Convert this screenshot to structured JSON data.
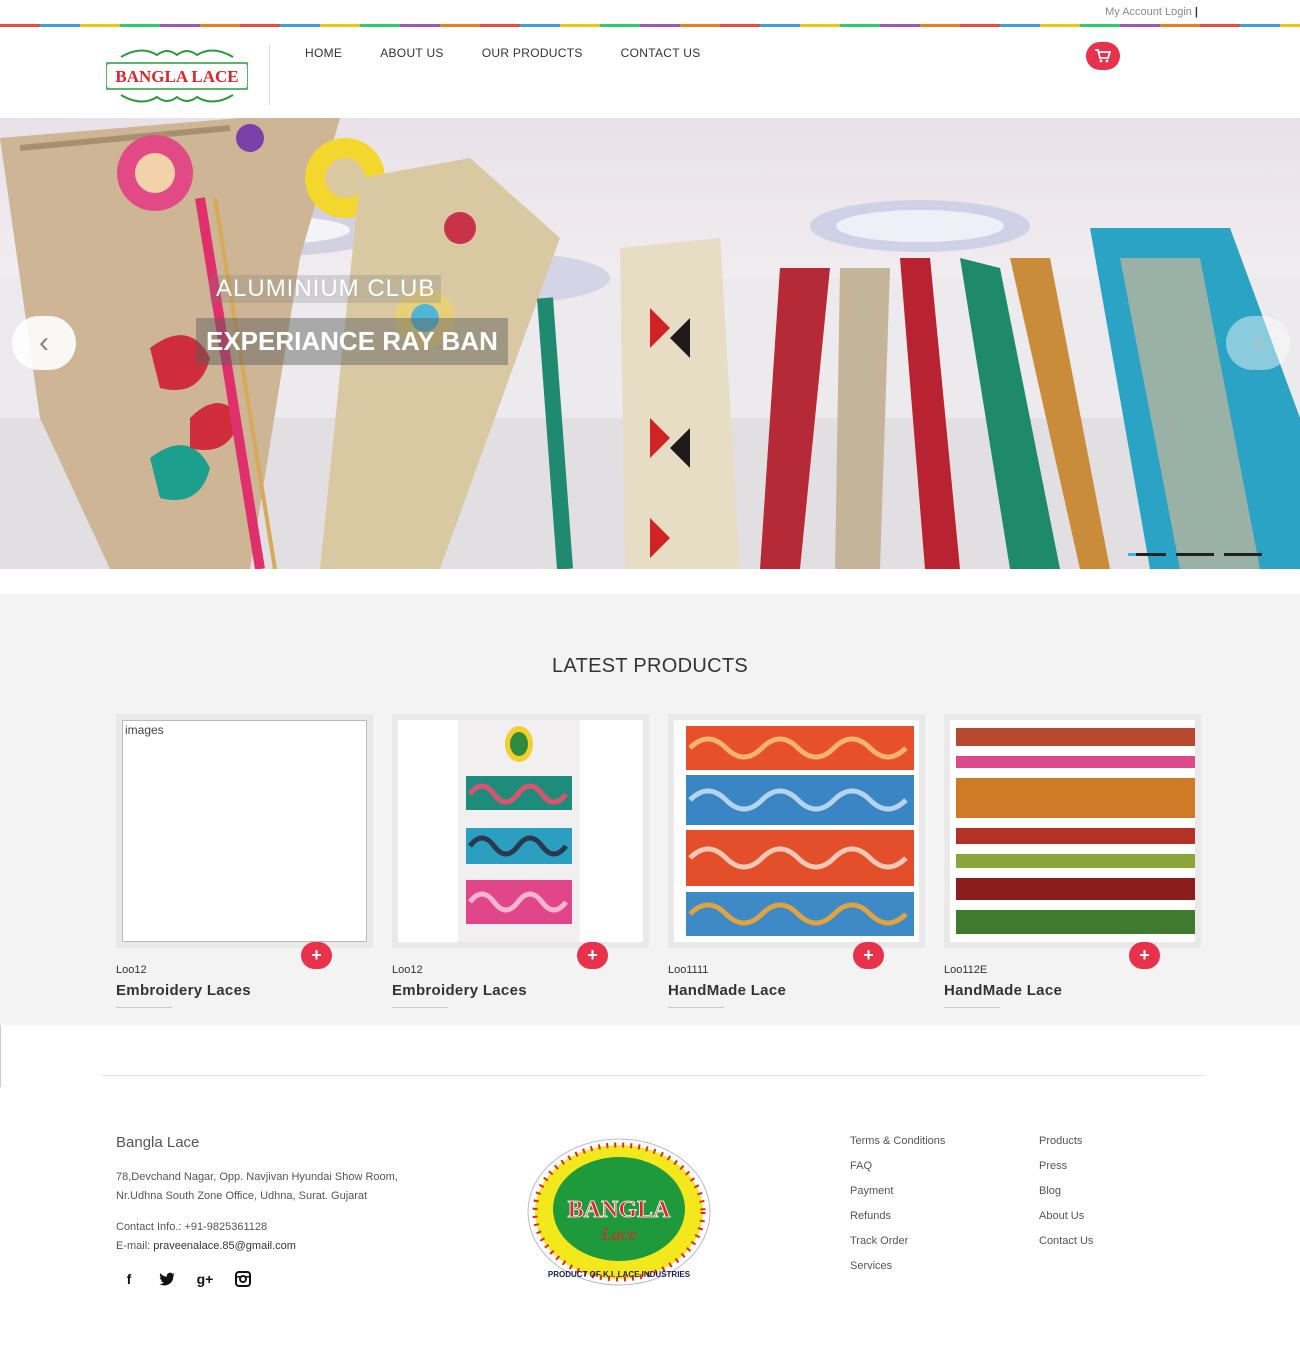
{
  "topbar": {
    "login": "My Account Login",
    "separator": "|"
  },
  "header": {
    "logo_text": "BANGLA LACE",
    "nav": [
      "HOME",
      "ABOUT US",
      "OUR PRODUCTS",
      "CONTACT US"
    ],
    "cart_icon": "shopping-cart-icon"
  },
  "hero": {
    "caption_top": "ALUMINIUM CLUB",
    "caption_main": "EXPERIANCE RAY BAN",
    "prev": "‹",
    "next": "›"
  },
  "products": {
    "heading": "LATEST PRODUCTS",
    "items": [
      {
        "code": "Loo12",
        "name": "Embroidery Laces",
        "image_alt": "images"
      },
      {
        "code": "Loo12",
        "name": "Embroidery Laces",
        "image_alt": ""
      },
      {
        "code": "Loo1111",
        "name": "HandMade Lace",
        "image_alt": ""
      },
      {
        "code": "Loo112E",
        "name": "HandMade Lace",
        "image_alt": ""
      }
    ],
    "add_label": "+"
  },
  "footer": {
    "brand": "Bangla Lace",
    "address_line1": "78,Devchand Nagar, Opp. Navjivan Hyundai Show Room,",
    "address_line2": "Nr.Udhna South Zone Office, Udhna, Surat. Gujarat",
    "contact": "Contact Info.: +91-9825361128",
    "email_label": "E-mail:",
    "email": "praveenalace.85@gmail.com",
    "logo_text_main": "BANGLA",
    "logo_text_sub": "Lace",
    "logo_ring": "PRODUCT OF K.I. LACE INDUSTRIES",
    "links_col1": [
      "Terms & Conditions",
      "FAQ",
      "Payment",
      "Refunds",
      "Track Order",
      "Services"
    ],
    "links_col2": [
      "Products",
      "Press",
      "Blog",
      "About Us",
      "Contact Us"
    ],
    "social": [
      "f",
      "t",
      "g+",
      "ig"
    ]
  }
}
